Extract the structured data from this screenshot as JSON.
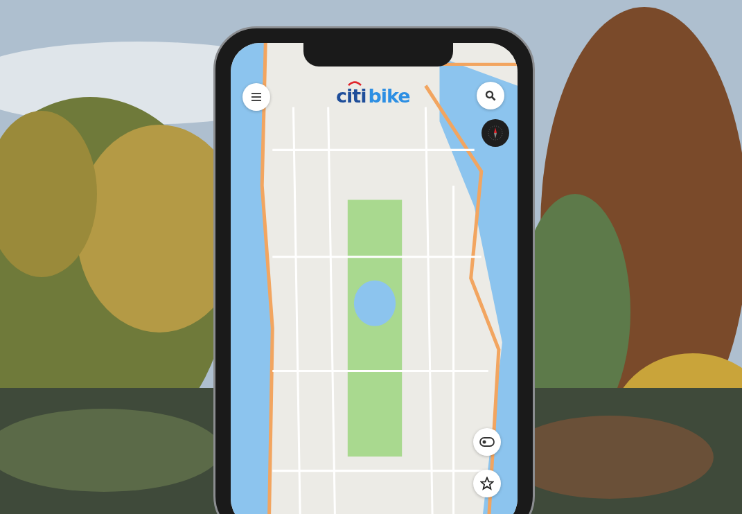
{
  "app": {
    "logo": [
      "citi",
      "bike"
    ]
  }
}
